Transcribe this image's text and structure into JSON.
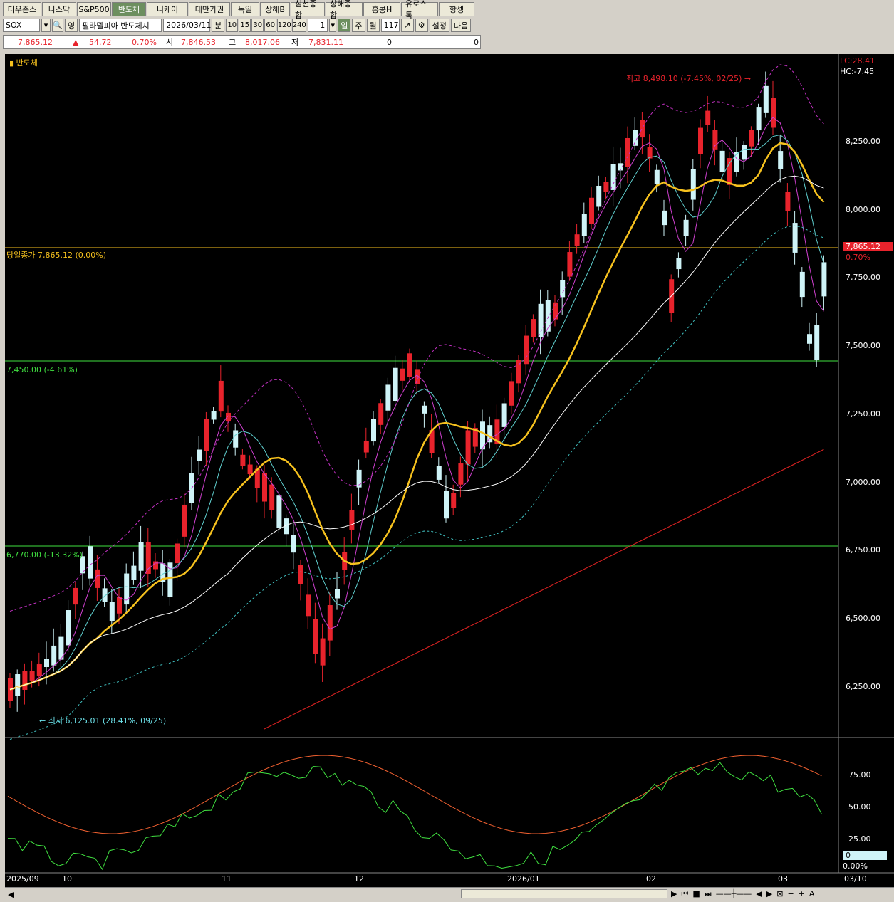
{
  "tabs": [
    {
      "label": "다우존스"
    },
    {
      "label": "나스닥"
    },
    {
      "label": "S&P500"
    },
    {
      "label": "반도체",
      "active": true
    },
    {
      "label": "니케이"
    },
    {
      "label": "대만가권"
    },
    {
      "label": "독일"
    },
    {
      "label": "상해B"
    },
    {
      "label": "심천종합"
    },
    {
      "label": "상해종합"
    },
    {
      "label": "홍콩H"
    },
    {
      "label": "유로스톡"
    },
    {
      "label": "항셍"
    }
  ],
  "toolbar": {
    "symbol": "SOX",
    "kind": "영",
    "name": "필라델피아 반도체지",
    "date": "2026/03/11",
    "min_label": "분",
    "periods": [
      "10",
      "15",
      "30",
      "60",
      "120",
      "240"
    ],
    "step": "1",
    "day": "일",
    "week": "주",
    "month": "월",
    "count": "117",
    "setting": "설정",
    "next": "다음"
  },
  "quote": {
    "price": "7,865.12",
    "change": "54.72",
    "pct": "0.70%",
    "open_label": "시",
    "open": "7,846.53",
    "high_label": "고",
    "high": "8,017.06",
    "low_label": "저",
    "low": "7,831.11",
    "v1": "0",
    "v2": "0"
  },
  "chart": {
    "title": "반도체",
    "y_ticks": [
      "8,250.00",
      "8,000.00",
      "7,750.00",
      "7,500.00",
      "7,250.00",
      "7,000.00",
      "6,750.00",
      "6,500.00",
      "6,250.00"
    ],
    "lc": "LC:28.41",
    "hc": "HC:-7.45",
    "last_price": "7,865.12",
    "last_pct": "0.70%",
    "close_line_label": "당일종가 7,865.12 (0.00%)",
    "hline1": "7,450.00 (-4.61%)",
    "hline2": "6,770.00 (-13.32%)",
    "max_label": "최고 8,498.10 (-7.45%, 02/25)",
    "min_label": "최저 6,125.01 (28.41%, 09/25)",
    "osc_ticks": [
      "75.00",
      "50.00",
      "25.00"
    ],
    "osc_v": "0",
    "osc_pct": "0.00%",
    "x_labels": [
      "2025/09",
      "10",
      "11",
      "12",
      "2026/01",
      "02",
      "03",
      "03/10"
    ]
  },
  "colors": {
    "up": "#e8232c",
    "down": "#cff4f8",
    "bg": "#000000",
    "ma_yellow": "#f7c21e"
  }
}
